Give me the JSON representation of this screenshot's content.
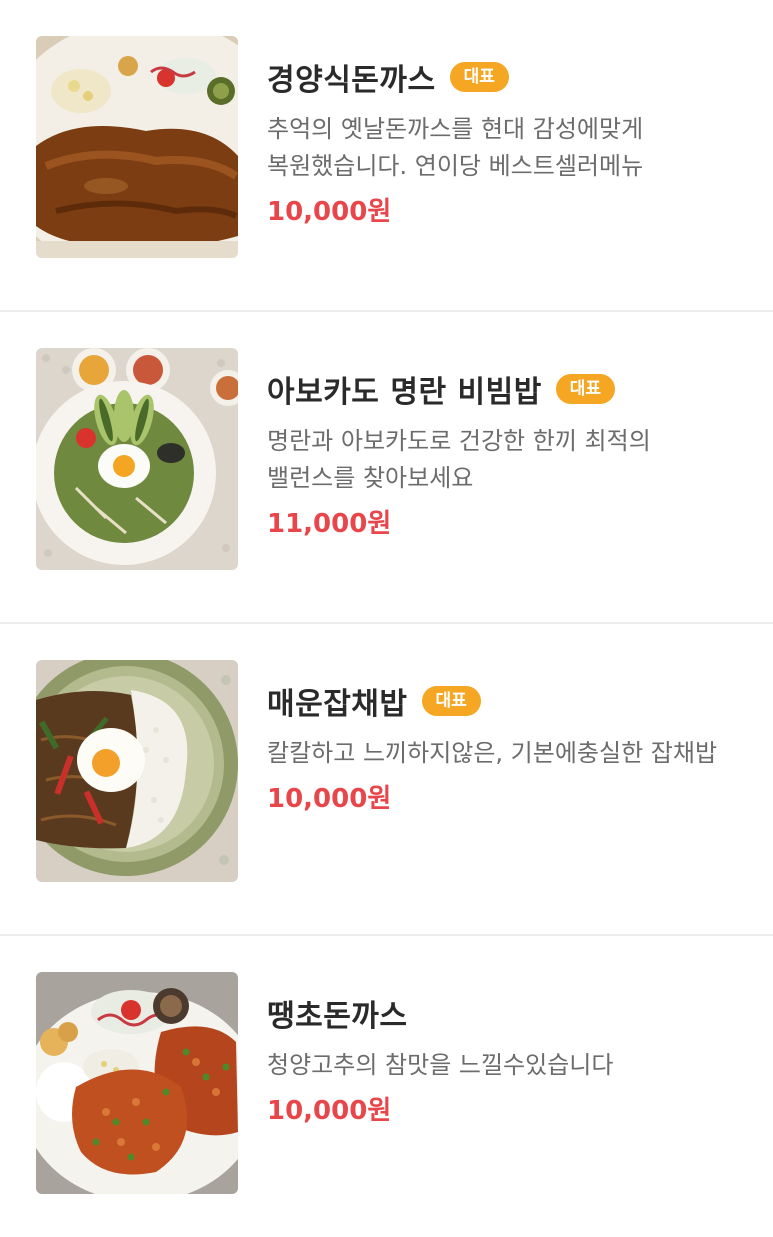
{
  "menu": {
    "items": [
      {
        "name": "경양식돈까스",
        "badge": "대표",
        "description": "추억의 옛날돈까스를 현대 감성에맞게 복원했습니다. 연이당 베스트셀러메뉴",
        "price": "10,000원",
        "photo": "katsu-demi-sauce-photo"
      },
      {
        "name": "아보카도 명란 비빔밥",
        "badge": "대표",
        "description": "명란과 아보카도로 건강한 한끼 최적의 밸런스를 찾아보세요",
        "price": "11,000원",
        "photo": "avocado-bibimbap-photo"
      },
      {
        "name": "매운잡채밥",
        "badge": "대표",
        "description": "칼칼하고 느끼하지않은, 기본에충실한 잡채밥",
        "price": "10,000원",
        "photo": "spicy-japchae-rice-photo"
      },
      {
        "name": "땡초돈까스",
        "badge": "",
        "description": "청양고추의 참맛을 느낄수있습니다",
        "price": "10,000원",
        "photo": "spicy-pepper-katsu-photo"
      }
    ]
  },
  "colors": {
    "badge_bg": "#f5a623",
    "price": "#e8464b",
    "title": "#2a2a2a",
    "description": "#6c6c6c",
    "divider": "#ededed"
  }
}
